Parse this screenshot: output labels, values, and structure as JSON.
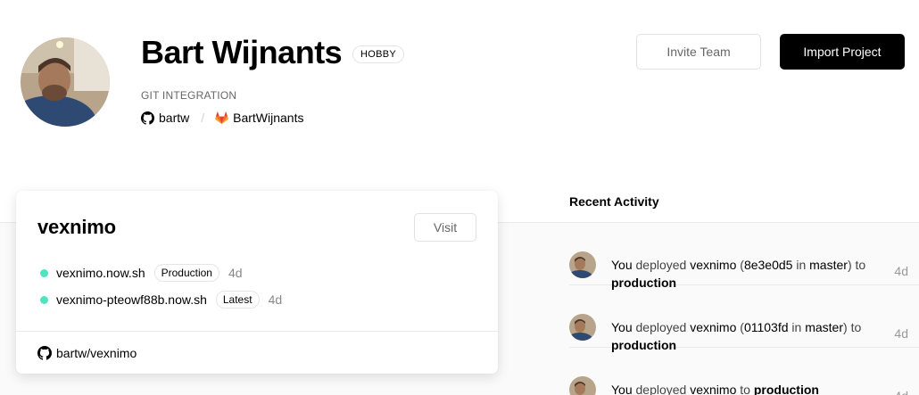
{
  "profile": {
    "name": "Bart Wijnants",
    "plan": "HOBBY",
    "git_label": "GIT INTEGRATION",
    "github_user": "bartw",
    "gitlab_user": "BartWijnants",
    "separator": "/"
  },
  "header_actions": {
    "invite_label": "Invite Team",
    "import_label": "Import Project"
  },
  "project": {
    "name": "vexnimo",
    "visit_label": "Visit",
    "deployments": [
      {
        "url": "vexnimo.now.sh",
        "tag": "Production",
        "age": "4d",
        "status_color": "#50e3c2"
      },
      {
        "url": "vexnimo-pteowf88b.now.sh",
        "tag": "Latest",
        "age": "4d",
        "status_color": "#50e3c2"
      }
    ],
    "repo": "bartw/vexnimo"
  },
  "activity": {
    "title": "Recent Activity",
    "items": [
      {
        "actor": "You",
        "verb": "deployed",
        "project": "vexnimo",
        "commit": "8e3e0d5",
        "in": "in",
        "branch": "master",
        "to": "to",
        "target": "production",
        "time": "4d"
      },
      {
        "actor": "You",
        "verb": "deployed",
        "project": "vexnimo",
        "commit": "01103fd",
        "in": "in",
        "branch": "master",
        "to": "to",
        "target": "production",
        "time": "4d"
      },
      {
        "actor": "You",
        "verb": "deployed",
        "project": "vexnimo",
        "to": "to",
        "target": "production",
        "time": "4d"
      }
    ]
  },
  "colors": {
    "accent": "#000000",
    "status_ready": "#50e3c2",
    "gitlab": "#e24329"
  }
}
